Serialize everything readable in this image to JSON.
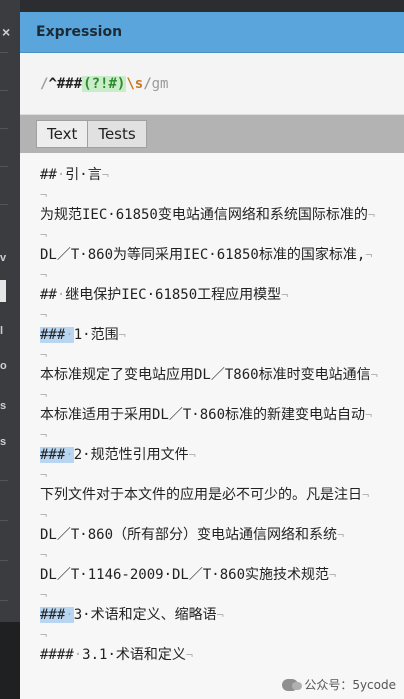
{
  "header": {
    "title": "Expression"
  },
  "expression": {
    "delimiter_open": "/",
    "caret": "^",
    "hashes": "###",
    "group": "(?!#)",
    "escape": "\\s",
    "delimiter_close": "/",
    "flags": "gm"
  },
  "tabs": [
    {
      "label": "Text"
    },
    {
      "label": "Tests"
    }
  ],
  "newline_glyph": "¬",
  "space_glyph": "·",
  "lines": [
    {
      "prefix": "##",
      "text": "引·言"
    },
    {
      "prefix": "",
      "text": ""
    },
    {
      "prefix": "",
      "text": "为规范IEC·61850变电站通信网络和系统国际标准的"
    },
    {
      "prefix": "",
      "text": ""
    },
    {
      "prefix": "",
      "text": "DL／T·860为等同采用IEC·61850标准的国家标准,"
    },
    {
      "prefix": "",
      "text": ""
    },
    {
      "prefix": "##",
      "text": "继电保护IEC·61850工程应用模型"
    },
    {
      "prefix": "",
      "text": ""
    },
    {
      "prefix": "###",
      "text": "1·范围"
    },
    {
      "prefix": "",
      "text": ""
    },
    {
      "prefix": "",
      "text": "本标准规定了变电站应用DL／T860标准时变电站通信"
    },
    {
      "prefix": "",
      "text": ""
    },
    {
      "prefix": "",
      "text": "本标准适用于采用DL／T·860标准的新建变电站自动"
    },
    {
      "prefix": "",
      "text": ""
    },
    {
      "prefix": "###",
      "text": "2·规范性引用文件"
    },
    {
      "prefix": "",
      "text": ""
    },
    {
      "prefix": "",
      "text": "下列文件对于本文件的应用是必不可少的。凡是注日"
    },
    {
      "prefix": "",
      "text": ""
    },
    {
      "prefix": "",
      "text": "DL／T·860（所有部分）变电站通信网络和系统"
    },
    {
      "prefix": "",
      "text": ""
    },
    {
      "prefix": "",
      "text": "DL／T·1146-2009·DL／T·860实施技术规范"
    },
    {
      "prefix": "",
      "text": ""
    },
    {
      "prefix": "###",
      "text": "3·术语和定义、缩略语"
    },
    {
      "prefix": "",
      "text": ""
    },
    {
      "prefix": "####",
      "text": "3.1·术语和定义"
    }
  ],
  "watermark": {
    "text": "公众号：5ycode"
  }
}
